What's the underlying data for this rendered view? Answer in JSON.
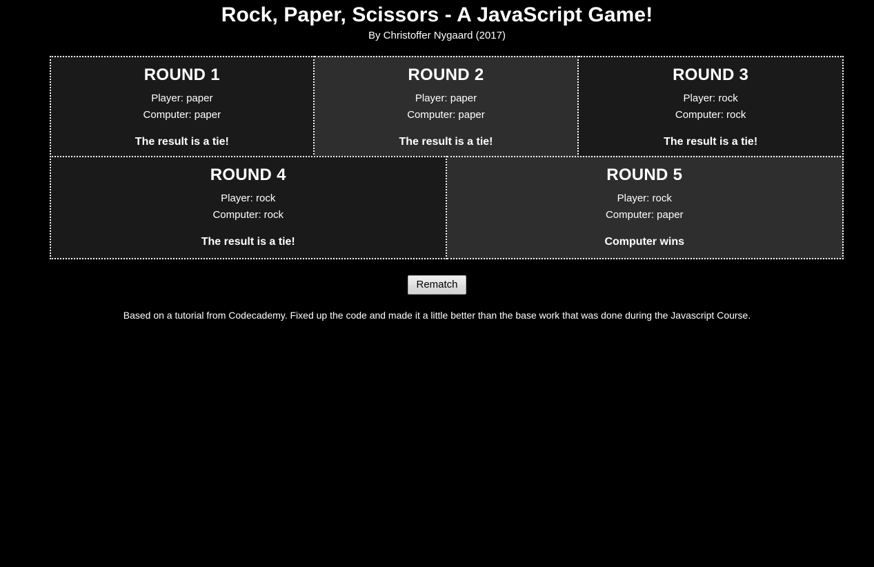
{
  "header": {
    "title": "Rock, Paper, Scissors - A JavaScript Game!",
    "subtitle": "By Christoffer Nygaard (2017)"
  },
  "colors": {
    "page_background": "#000000",
    "card_dark": "#1a1a1a",
    "card_light": "#2e2e2e",
    "border": "#ffffff",
    "text": "#ffffff",
    "button_face": "#e0e0e0",
    "button_text": "#000000"
  },
  "scoreboard": {
    "rounds": [
      {
        "heading": "ROUND 1",
        "player_line": "Player: paper",
        "computer_line": "Computer: paper",
        "result": "The result is a tie!",
        "player_choice": "paper",
        "computer_choice": "paper",
        "shade": "dark"
      },
      {
        "heading": "ROUND 2",
        "player_line": "Player: paper",
        "computer_line": "Computer: paper",
        "result": "The result is a tie!",
        "player_choice": "paper",
        "computer_choice": "paper",
        "shade": "light"
      },
      {
        "heading": "ROUND 3",
        "player_line": "Player: rock",
        "computer_line": "Computer: rock",
        "result": "The result is a tie!",
        "player_choice": "rock",
        "computer_choice": "rock",
        "shade": "dark"
      },
      {
        "heading": "ROUND 4",
        "player_line": "Player: rock",
        "computer_line": "Computer: rock",
        "result": "The result is a tie!",
        "player_choice": "rock",
        "computer_choice": "rock",
        "shade": "dark"
      },
      {
        "heading": "ROUND 5",
        "player_line": "Player: rock",
        "computer_line": "Computer: paper",
        "result": "Computer wins",
        "player_choice": "rock",
        "computer_choice": "paper",
        "shade": "light"
      }
    ]
  },
  "controls": {
    "rematch_label": "Rematch"
  },
  "footer": {
    "note": "Based on a tutorial from Codecademy. Fixed up the code and made it a little better than the base work that was done during the Javascript Course."
  }
}
